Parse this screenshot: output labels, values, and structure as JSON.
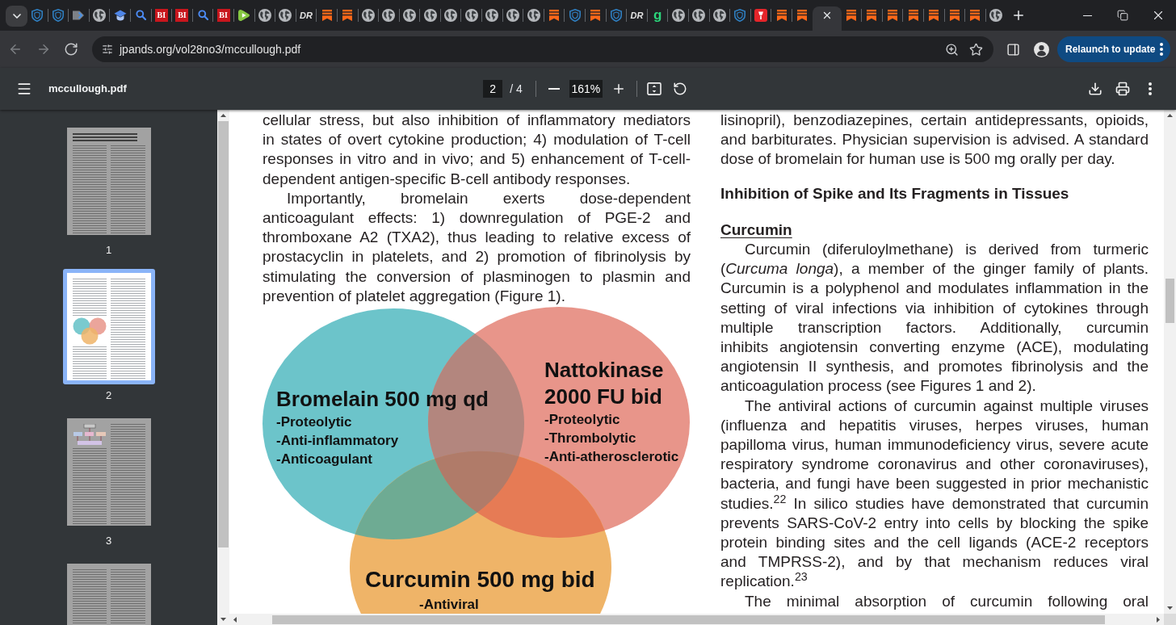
{
  "tab_strip": {
    "tabs": [
      {
        "kind": "shield",
        "selected": false
      },
      {
        "kind": "shield",
        "selected": false
      },
      {
        "kind": "tag",
        "selected": false
      },
      {
        "kind": "globe",
        "selected": false
      },
      {
        "kind": "cap",
        "selected": false
      },
      {
        "kind": "search",
        "selected": false
      },
      {
        "kind": "badge",
        "text": "BI",
        "selected": false
      },
      {
        "kind": "badge",
        "text": "BI",
        "selected": false
      },
      {
        "kind": "search",
        "selected": false
      },
      {
        "kind": "badge",
        "text": "BI",
        "selected": false
      },
      {
        "kind": "play",
        "selected": false
      },
      {
        "kind": "globe",
        "selected": false
      },
      {
        "kind": "globe",
        "selected": false
      },
      {
        "kind": "wordmark",
        "text": "DR",
        "selected": false
      },
      {
        "kind": "bookmark",
        "selected": false
      },
      {
        "kind": "bookmark",
        "selected": false
      },
      {
        "kind": "globe",
        "selected": false
      },
      {
        "kind": "globe",
        "selected": false
      },
      {
        "kind": "globe",
        "selected": false
      },
      {
        "kind": "globe",
        "selected": false
      },
      {
        "kind": "globe",
        "selected": false
      },
      {
        "kind": "globe",
        "selected": false
      },
      {
        "kind": "globe",
        "selected": false
      },
      {
        "kind": "globe",
        "selected": false
      },
      {
        "kind": "globe",
        "selected": false
      },
      {
        "kind": "bookmark",
        "selected": false
      },
      {
        "kind": "shield",
        "selected": false
      },
      {
        "kind": "bookmark",
        "selected": false
      },
      {
        "kind": "shield",
        "selected": false
      },
      {
        "kind": "wordmark",
        "text": "DR",
        "selected": false
      },
      {
        "kind": "letter",
        "text": "g",
        "selected": false
      },
      {
        "kind": "globe",
        "selected": false
      },
      {
        "kind": "globe",
        "selected": false
      },
      {
        "kind": "globe",
        "selected": false
      },
      {
        "kind": "shield",
        "selected": false
      },
      {
        "kind": "torch",
        "selected": false
      },
      {
        "kind": "bookmark",
        "selected": false
      },
      {
        "kind": "bookmark",
        "selected": false
      },
      {
        "kind": "close",
        "selected": true
      },
      {
        "kind": "bookmark",
        "selected": false
      },
      {
        "kind": "bookmark",
        "selected": false
      },
      {
        "kind": "bookmark",
        "selected": false
      },
      {
        "kind": "bookmark",
        "selected": false
      },
      {
        "kind": "bookmark",
        "selected": false
      },
      {
        "kind": "bookmark",
        "selected": false
      },
      {
        "kind": "bookmark",
        "selected": false
      },
      {
        "kind": "globe",
        "selected": false
      }
    ]
  },
  "toolbar": {
    "nav": [
      {
        "kind": "back",
        "disabled": true
      },
      {
        "kind": "forward",
        "disabled": true
      },
      {
        "kind": "reload",
        "disabled": false
      }
    ],
    "url": "jpands.org/vol28no3/mccullough.pdf",
    "relaunch_button": "Relaunch to update"
  },
  "pdf_toolbar": {
    "title": "mccullough.pdf",
    "page": "2",
    "page_count": "/ 4",
    "zoom": "161%"
  },
  "sidebar": {
    "pages": [
      {
        "label": "1",
        "kind": "title",
        "selected": false
      },
      {
        "label": "2",
        "kind": "figure",
        "selected": true
      },
      {
        "label": "3",
        "kind": "diagram",
        "selected": false
      },
      {
        "kind": "text",
        "selected": false
      }
    ]
  },
  "document": {
    "left_column": [
      {
        "kind": "paragraph",
        "indent": false,
        "lines": [
          "cellular stress, but also inhibition of inflammatory mediators",
          "in states of overt cytokine production; 4) modulation of T-cell",
          "responses in vitro and in vivo; and 5) enhancement of T-cell-",
          "dependent antigen-specific B-cell antibody responses."
        ]
      },
      {
        "kind": "paragraph",
        "indent": true,
        "lines": [
          "Importantly, bromelain exerts dose-dependent",
          "anticoagulant effects: 1) downregulation of PGE-2 and",
          "thromboxane A2 (TXA2), thus leading to relative excess of",
          "prostacyclin in platelets, and 2) promotion of fibrinolysis by",
          "stimulating the conversion of plasminogen to plasmin and",
          "prevention of platelet aggregation (Figure 1)."
        ]
      },
      {
        "kind": "figure",
        "sets": [
          {
            "title": [
              "Bromelain 500 mg qd"
            ],
            "items": [
              "-Proteolytic",
              "-Anti-inflammatory",
              "-Anticoagulant"
            ],
            "color": "#6cc4ca"
          },
          {
            "title": [
              "Nattokinase",
              "2000 FU bid"
            ],
            "items": [
              "-Proteolytic",
              "-Thrombolytic",
              "-Anti-atherosclerotic"
            ],
            "color": "#e8958a"
          },
          {
            "title": [
              "Curcumin 500 mg bid"
            ],
            "items": [
              "-Antiviral"
            ],
            "color": "#efb468"
          }
        ]
      }
    ],
    "right_column": [
      {
        "kind": "paragraph",
        "indent": false,
        "lines": [
          "lisinopril), benzodiazepines, certain antidepressants, opioids,",
          "and barbiturates. Physician supervision is advised. A standard",
          "dose of bromelain for human use is 500 mg orally per day."
        ]
      },
      {
        "kind": "heading",
        "text": "Inhibition of Spike and Its Fragments in Tissues"
      },
      {
        "kind": "subheading",
        "text": "Curcumin"
      },
      {
        "kind": "paragraph",
        "indent": true,
        "lines": [
          "Curcumin (diferuloylmethane) is derived from turmeric",
          "(*Curcuma longa*), a member of the ginger family of plants.",
          "Curcumin is a polyphenol and modulates inflammation in the",
          "setting of viral infections via inhibition of cytokines through",
          "multiple transcription factors. Additionally, curcumin",
          "inhibits angiotensin converting enzyme (ACE), modulating",
          "angiotensin II synthesis, and promotes fibrinolysis and the",
          "anticoagulation process (see Figures 1 and 2)."
        ]
      },
      {
        "kind": "paragraph",
        "indent": true,
        "lines": [
          "The antiviral actions of curcumin against multiple viruses",
          "(influenza and hepatitis viruses, herpes viruses, human",
          "papilloma virus, human immunodeficiency virus, severe acute",
          "respiratory syndrome coronavirus and other coronaviruses),",
          "bacteria, and fungi have been suggested in prior mechanistic",
          "studies.$^{22}$ In silico studies have demonstrated that curcumin",
          "prevents SARS-CoV-2 entry into cells by blocking the spike",
          "protein binding sites and the cell ligands (ACE-2 receptors",
          "and TMPRSS-2), and by that mechanism reduces viral",
          "replication.$^{23}$"
        ]
      },
      {
        "kind": "paragraph",
        "indent": true,
        "continues": true,
        "lines": [
          "The minimal absorption of curcumin following oral"
        ]
      }
    ]
  }
}
